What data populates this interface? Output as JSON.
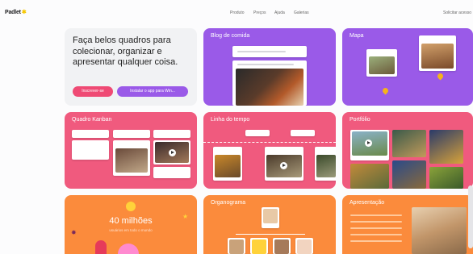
{
  "brand": {
    "name": "Padlet"
  },
  "nav": {
    "items": [
      "Produto",
      "Preços",
      "Ajuda",
      "Galerias"
    ],
    "signin": "Solicitar acesso"
  },
  "hero": {
    "headline": "Faça belos quadros para colecionar, organizar e apresentar qualquer coisa.",
    "signup": "Inscrever-se",
    "install": "Instalar o app para Win..."
  },
  "cards": {
    "blog": "Blog de comida",
    "map": "Mapa",
    "kanban": "Quadro Kanban",
    "timeline": "Linha do tempo",
    "portfolio": "Portfólio",
    "stats_number": "40 milhões",
    "stats_caption": "usuários em todo o mundo",
    "org": "Organograma",
    "presentation": "Apresentação"
  },
  "colors": {
    "purple": "#9a5ae8",
    "pink": "#f05a7e",
    "orange": "#fb8b3c"
  }
}
